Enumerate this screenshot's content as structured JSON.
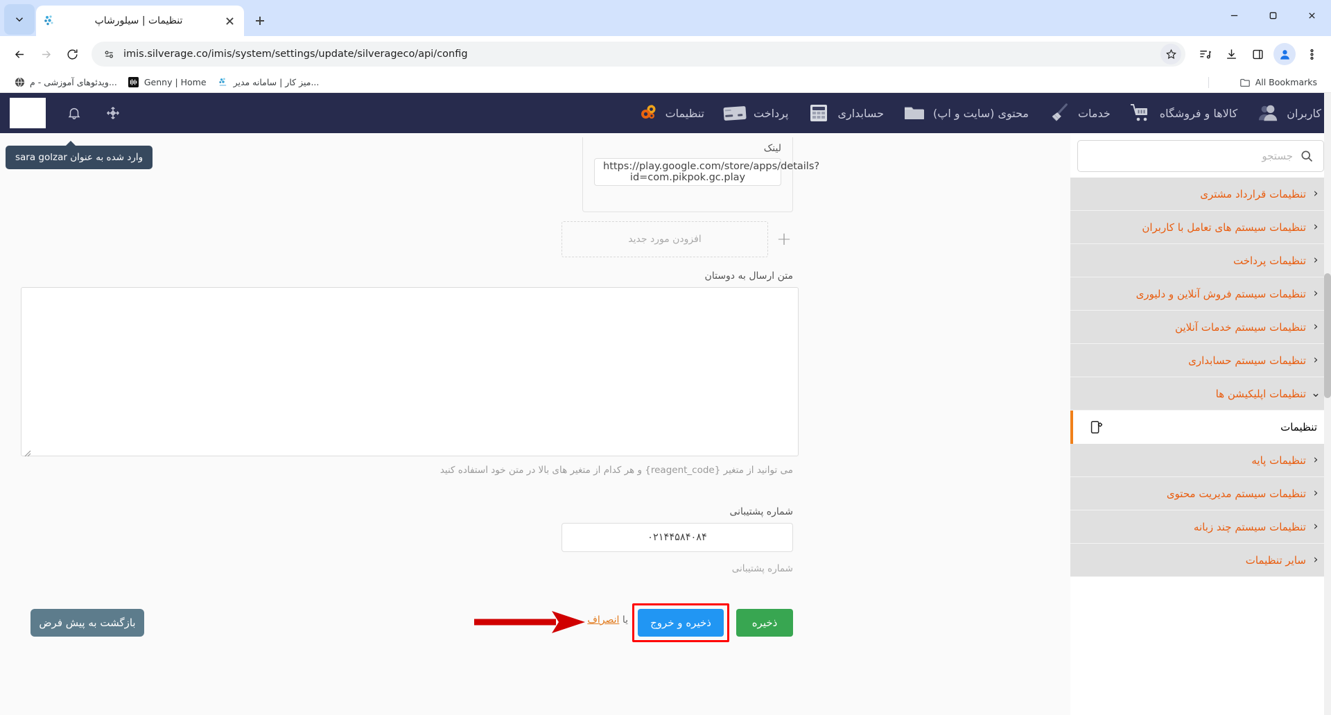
{
  "browser": {
    "tab": {
      "title": "تنظیمات | سیلورشاپ",
      "favicon": "silverage-logo-icon"
    },
    "new_tab_label": "+",
    "url": "imis.silverage.co/imis/system/settings/update/silverageco/api/config",
    "bookmarks": [
      {
        "label": "ویدئوهای آموزشی - م...",
        "icon": "globe-icon"
      },
      {
        "label": "Genny | Home",
        "icon": "genny-icon"
      },
      {
        "label": "میز کار | سامانه مدیر...",
        "icon": "silverage-icon"
      }
    ],
    "all_bookmarks_label": "All Bookmarks",
    "toolbar_icons": [
      "back-icon",
      "forward-icon",
      "reload-icon",
      "site-info-icon",
      "bookmark-star-icon",
      "reading-list-icon",
      "downloads-icon",
      "side-panel-icon",
      "profile-icon",
      "chrome-menu-icon"
    ],
    "window_controls": [
      "minimize",
      "maximize",
      "close"
    ]
  },
  "app": {
    "nav_right": [
      {
        "label": "کاربران",
        "icon": "users-icon"
      },
      {
        "label": "کالاها و فروشگاه",
        "icon": "cart-icon"
      },
      {
        "label": "خدمات",
        "icon": "broom-icon"
      },
      {
        "label": "محتوی (سایت و اپ)",
        "icon": "folder-icon"
      },
      {
        "label": "حسابداری",
        "icon": "calculator-icon"
      },
      {
        "label": "پرداخت",
        "icon": "credit-card-icon"
      },
      {
        "label": "تنظیمات",
        "icon": "gears-icon"
      }
    ],
    "nav_left_icons": [
      "brand-logo",
      "bell-icon",
      "move-icon"
    ],
    "tooltip": "وارد شده به عنوان sara golzar"
  },
  "sidebar": {
    "search": {
      "placeholder": "جستجو",
      "value": "",
      "icon": "search-icon"
    },
    "items": [
      {
        "label": "تنظیمات قرارداد مشتری",
        "chevron": "‹",
        "active": false
      },
      {
        "label": "تنظیمات سیستم های تعامل با کاربران",
        "chevron": "‹",
        "active": false
      },
      {
        "label": "تنظیمات پرداخت",
        "chevron": "‹",
        "active": false
      },
      {
        "label": "تنظیمات سیستم فروش آنلاین و دلیوری",
        "chevron": "‹",
        "active": false
      },
      {
        "label": "تنظیمات سیستم خدمات آنلاین",
        "chevron": "‹",
        "active": false
      },
      {
        "label": "تنظیمات سیستم حسابداری",
        "chevron": "‹",
        "active": false
      },
      {
        "label": "تنظیمات اپلیکیشن ها",
        "chevron": "⌄",
        "active": false
      },
      {
        "label": "تنظیمات",
        "chevron": "",
        "active": true,
        "icon": "mobile-settings-icon"
      },
      {
        "label": "تنظیمات پایه",
        "chevron": "‹",
        "active": false
      },
      {
        "label": "تنظیمات سیستم مدیریت محتوی",
        "chevron": "‹",
        "active": false
      },
      {
        "label": "تنظیمات سیستم چند زبانه",
        "chevron": "‹",
        "active": false
      },
      {
        "label": "سایر تنظیمات",
        "chevron": "‹",
        "active": false
      }
    ]
  },
  "form": {
    "link_label": "لینک",
    "link_value": "https://play.google.com/store/apps/details?id=com.pikpok.gc.play",
    "add_new_label": "افزودن مورد جدید",
    "add_plus": "+",
    "share_text_label": "متن ارسال به دوستان",
    "share_text_value": "",
    "hint": "می توانید از متغیر {reagent_code} و هر کدام از متغیر های بالا در متن خود استفاده کنید",
    "support_number_label": "شماره پشتیبانی",
    "support_number_value": "۰۲۱۴۴۵۸۴۰۸۴",
    "support_number_hint": "شماره پشتیبانی"
  },
  "actions": {
    "reset_default": "بازگشت به پیش فرض",
    "save": "ذخیره",
    "save_and_exit": "ذخیره و خروج",
    "or_prefix": "یا",
    "cancel": "انصراف"
  },
  "colors": {
    "navbar": "#272b4d",
    "accent_orange": "#e95d0f",
    "save_green": "#38a651",
    "save_exit_blue": "#2196f3",
    "highlight_red": "#ff0000",
    "default_btn": "#5d7c8c"
  }
}
